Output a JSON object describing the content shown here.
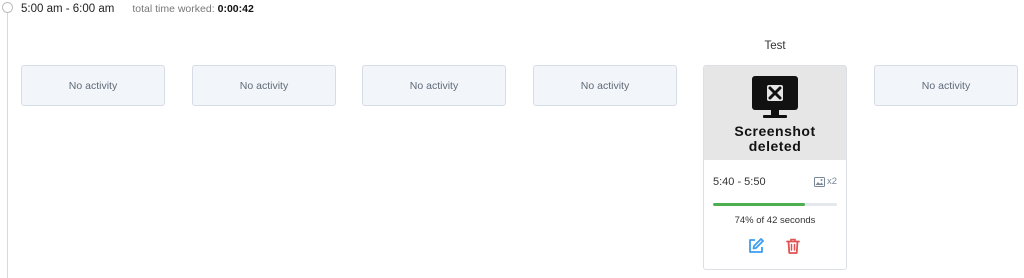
{
  "header": {
    "time_range": "5:00 am - 6:00 am",
    "total_label": "total time worked:",
    "total_value": "0:00:42"
  },
  "slots": [
    {
      "label": "No activity"
    },
    {
      "label": "No activity"
    },
    {
      "label": "No activity"
    },
    {
      "label": "No activity"
    },
    {
      "label": "No activity"
    }
  ],
  "activity_card": {
    "project_name": "Test",
    "thumbnail_line1": "Screenshot",
    "thumbnail_line2": "deleted",
    "time_range": "5:40 - 5:50",
    "screenshot_count": "x2",
    "progress_percent": 74,
    "progress_text": "74% of 42 seconds",
    "icons": {
      "thumbnail": "monitor-deleted-icon",
      "count": "image-icon",
      "edit": "edit-icon",
      "delete": "trash-icon"
    }
  },
  "colors": {
    "progress": "#4caf50",
    "edit": "#3d9df0",
    "delete": "#e05252"
  }
}
